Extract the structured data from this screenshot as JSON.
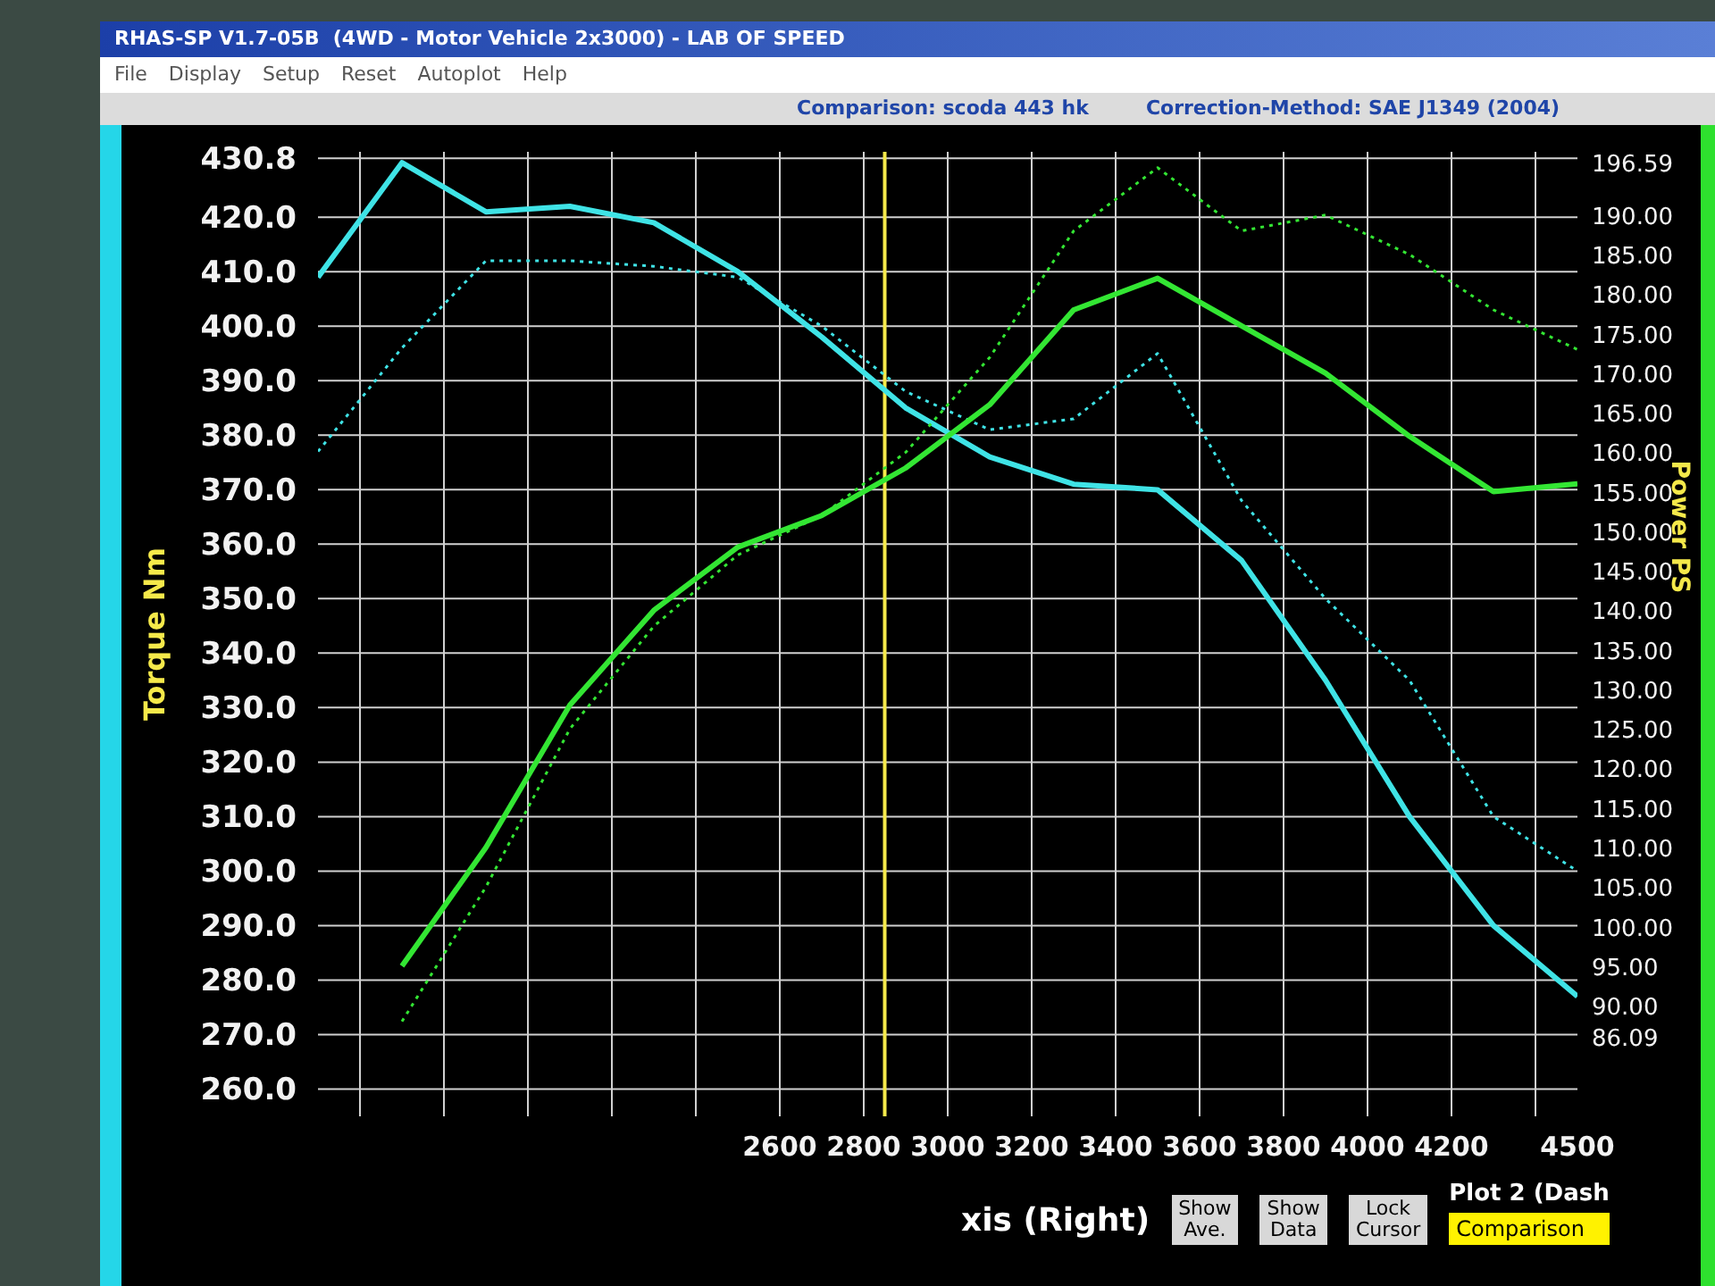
{
  "window": {
    "title": "RHAS-SP V1.7-05B  (4WD - Motor Vehicle 2x3000) - LAB OF SPEED"
  },
  "menu": [
    "File",
    "Display",
    "Setup",
    "Reset",
    "Autoplot",
    "Help"
  ],
  "info_bar": {
    "comparison": "Comparison: scoda 443 hk",
    "correction": "Correction-Method: SAE J1349 (2004)"
  },
  "chart": {
    "chart_data": {
      "type": "line",
      "grid": true,
      "ref_lines": [
        {
          "axis": "x",
          "value": 2850,
          "color": "#f5e94a"
        }
      ],
      "ylabel": "Torque Nm",
      "y2label": "Power PS",
      "x": [
        1500,
        1700,
        1900,
        2100,
        2300,
        2500,
        2700,
        2900,
        3100,
        3300,
        3500,
        3700,
        3900,
        4100,
        4300,
        4500
      ],
      "xlim": [
        1500,
        4500
      ],
      "ylim": [
        255,
        432
      ],
      "y2lim": [
        76,
        198
      ],
      "xticks": [
        2600,
        2800,
        3000,
        3200,
        3400,
        3600,
        3800,
        4000,
        4200,
        4500
      ],
      "yticks": [
        {
          "value": 430.8,
          "label": "430.8"
        },
        {
          "value": 420,
          "label": "420.0"
        },
        {
          "value": 410,
          "label": "410.0"
        },
        {
          "value": 400,
          "label": "400.0"
        },
        {
          "value": 390,
          "label": "390.0"
        },
        {
          "value": 380,
          "label": "380.0"
        },
        {
          "value": 370,
          "label": "370.0"
        },
        {
          "value": 360,
          "label": "360.0"
        },
        {
          "value": 350,
          "label": "350.0"
        },
        {
          "value": 340,
          "label": "340.0"
        },
        {
          "value": 330,
          "label": "330.0"
        },
        {
          "value": 320,
          "label": "320.0"
        },
        {
          "value": 310,
          "label": "310.0"
        },
        {
          "value": 300,
          "label": "300.0"
        },
        {
          "value": 290,
          "label": "290.0"
        },
        {
          "value": 280,
          "label": "280.0"
        },
        {
          "value": 270,
          "label": "270.0"
        },
        {
          "value": 260,
          "label": "260.0"
        }
      ],
      "y2ticks": [
        {
          "value": 196.59,
          "label": "196.59"
        },
        {
          "value": 190,
          "label": "190.00"
        },
        {
          "value": 185,
          "label": "185.00"
        },
        {
          "value": 180,
          "label": "180.00"
        },
        {
          "value": 175,
          "label": "175.00"
        },
        {
          "value": 170,
          "label": "170.00"
        },
        {
          "value": 165,
          "label": "165.00"
        },
        {
          "value": 160,
          "label": "160.00"
        },
        {
          "value": 155,
          "label": "155.00"
        },
        {
          "value": 150,
          "label": "150.00"
        },
        {
          "value": 145,
          "label": "145.00"
        },
        {
          "value": 140,
          "label": "140.00"
        },
        {
          "value": 135,
          "label": "135.00"
        },
        {
          "value": 130,
          "label": "130.00"
        },
        {
          "value": 125,
          "label": "125.00"
        },
        {
          "value": 120,
          "label": "120.00"
        },
        {
          "value": 115,
          "label": "115.00"
        },
        {
          "value": 110,
          "label": "110.00"
        },
        {
          "value": 105,
          "label": "105.00"
        },
        {
          "value": 100,
          "label": "100.00"
        },
        {
          "value": 95,
          "label": "95.00"
        },
        {
          "value": 90,
          "label": "90.00"
        },
        {
          "value": 86.09,
          "label": "86.09"
        }
      ],
      "series": [
        {
          "color": "#3fe3e6",
          "line_style": "solid",
          "values": [
            409,
            430,
            421,
            422,
            419,
            410,
            398,
            385,
            376,
            371,
            370,
            357,
            335,
            310,
            290,
            277
          ]
        },
        {
          "color": "#3fe3e6",
          "line_style": "dotted",
          "values": [
            377,
            396,
            412,
            412,
            411,
            409,
            400,
            388,
            381,
            383,
            395,
            368,
            350,
            335,
            310,
            300
          ]
        },
        {
          "color": "#33e633",
          "axis": "y2",
          "line_style": "solid",
          "values": [
            null,
            95,
            110,
            128,
            140,
            148,
            152,
            158,
            166,
            178,
            182,
            176,
            170,
            162,
            155,
            156
          ]
        },
        {
          "color": "#33e633",
          "axis": "y2",
          "line_style": "dotted",
          "values": [
            null,
            88,
            105,
            125,
            138,
            147,
            152,
            160,
            172,
            188,
            196,
            188,
            190,
            185,
            178,
            173
          ]
        }
      ]
    }
  },
  "bottom_panel": {
    "axis_label": "xis (Right)",
    "buttons": [
      {
        "line1": "Show",
        "line2": "Ave."
      },
      {
        "line1": "Show",
        "line2": "Data"
      },
      {
        "line1": "Lock",
        "line2": "Cursor"
      }
    ],
    "plot_label": "Plot 2 (Dash",
    "plot_field": "Comparison"
  }
}
